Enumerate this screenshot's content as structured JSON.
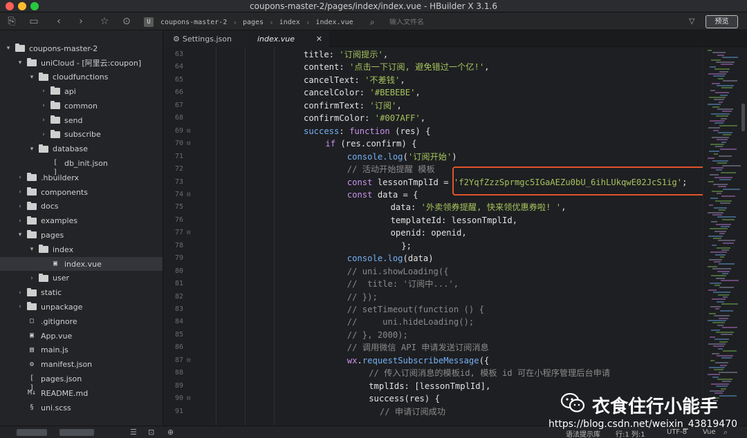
{
  "window": {
    "title": "coupons-master-2/pages/index/index.vue - HBuilder X 3.1.6"
  },
  "toolbar": {
    "breadcrumb": [
      "coupons-master-2",
      "pages",
      "index",
      "index.vue"
    ],
    "file_input_placeholder": "输入文件名",
    "preview_label": "预览"
  },
  "sidebar": {
    "items": [
      {
        "label": "coupons-master-2",
        "level": 0,
        "arrow": "▾",
        "icon": "folder-icon"
      },
      {
        "label": "uniCloud - [阿里云:coupon]",
        "level": 1,
        "arrow": "▾",
        "icon": "folder-icon"
      },
      {
        "label": "cloudfunctions",
        "level": 2,
        "arrow": "▾",
        "icon": "folder-icon"
      },
      {
        "label": "api",
        "level": 3,
        "arrow": "›",
        "icon": "folder-icon"
      },
      {
        "label": "common",
        "level": 3,
        "arrow": "›",
        "icon": "folder-icon"
      },
      {
        "label": "send",
        "level": 3,
        "arrow": "›",
        "icon": "folder-icon"
      },
      {
        "label": "subscribe",
        "level": 3,
        "arrow": "›",
        "icon": "folder-icon"
      },
      {
        "label": "database",
        "level": 2,
        "arrow": "▾",
        "icon": "folder-icon"
      },
      {
        "label": "db_init.json",
        "level": 3,
        "arrow": "",
        "icon": "json-file-icon"
      },
      {
        "label": ".hbuilderx",
        "level": 1,
        "arrow": "›",
        "icon": "folder-icon"
      },
      {
        "label": "components",
        "level": 1,
        "arrow": "›",
        "icon": "folder-icon"
      },
      {
        "label": "docs",
        "level": 1,
        "arrow": "›",
        "icon": "folder-icon"
      },
      {
        "label": "examples",
        "level": 1,
        "arrow": "›",
        "icon": "folder-icon"
      },
      {
        "label": "pages",
        "level": 1,
        "arrow": "▾",
        "icon": "folder-icon"
      },
      {
        "label": "index",
        "level": 2,
        "arrow": "▾",
        "icon": "folder-icon"
      },
      {
        "label": "index.vue",
        "level": 3,
        "arrow": "",
        "icon": "vue-file-icon",
        "selected": true
      },
      {
        "label": "user",
        "level": 2,
        "arrow": "›",
        "icon": "folder-icon"
      },
      {
        "label": "static",
        "level": 1,
        "arrow": "›",
        "icon": "folder-icon"
      },
      {
        "label": "unpackage",
        "level": 1,
        "arrow": "›",
        "icon": "folder-icon"
      },
      {
        "label": ".gitignore",
        "level": 1,
        "arrow": "",
        "icon": "file-icon"
      },
      {
        "label": "App.vue",
        "level": 1,
        "arrow": "",
        "icon": "vue-file-icon"
      },
      {
        "label": "main.js",
        "level": 1,
        "arrow": "",
        "icon": "js-file-icon"
      },
      {
        "label": "manifest.json",
        "level": 1,
        "arrow": "",
        "icon": "settings-file-icon"
      },
      {
        "label": "pages.json",
        "level": 1,
        "arrow": "",
        "icon": "json-file-icon"
      },
      {
        "label": "README.md",
        "level": 1,
        "arrow": "",
        "icon": "markdown-file-icon"
      },
      {
        "label": "uni.scss",
        "level": 1,
        "arrow": "",
        "icon": "scss-file-icon"
      }
    ]
  },
  "tabs": [
    {
      "label": "Settings.json",
      "active": false
    },
    {
      "label": "index.vue",
      "active": true
    }
  ],
  "editor": {
    "lines": [
      {
        "n": "63",
        "fold": "",
        "indent": 20,
        "tokens": [
          [
            "p",
            "title: "
          ],
          [
            "s",
            "'订阅提示'"
          ],
          [
            "p",
            ","
          ]
        ]
      },
      {
        "n": "64",
        "fold": "",
        "indent": 20,
        "tokens": [
          [
            "p",
            "content: "
          ],
          [
            "s",
            "'点击一下订阅, 避免错过一个亿!'"
          ],
          [
            "p",
            ","
          ]
        ]
      },
      {
        "n": "65",
        "fold": "",
        "indent": 20,
        "tokens": [
          [
            "p",
            "cancelText: "
          ],
          [
            "s",
            "'不差钱'"
          ],
          [
            "p",
            ","
          ]
        ]
      },
      {
        "n": "66",
        "fold": "",
        "indent": 20,
        "tokens": [
          [
            "p",
            "cancelColor: "
          ],
          [
            "s",
            "'#BEBEBE'"
          ],
          [
            "p",
            ","
          ]
        ]
      },
      {
        "n": "67",
        "fold": "",
        "indent": 20,
        "tokens": [
          [
            "p",
            "confirmText: "
          ],
          [
            "s",
            "'订阅'"
          ],
          [
            "p",
            ","
          ]
        ]
      },
      {
        "n": "68",
        "fold": "",
        "indent": 20,
        "tokens": [
          [
            "p",
            "confirmColor: "
          ],
          [
            "s",
            "'#007AFF'"
          ],
          [
            "p",
            ","
          ]
        ]
      },
      {
        "n": "69",
        "fold": "⊟",
        "indent": 20,
        "tokens": [
          [
            "b",
            "success"
          ],
          [
            "p",
            ": "
          ],
          [
            "k",
            "function"
          ],
          [
            "p",
            " (res) {"
          ]
        ]
      },
      {
        "n": "70",
        "fold": "⊟",
        "indent": 24,
        "tokens": [
          [
            "k",
            "if"
          ],
          [
            "p",
            " (res.confirm) {"
          ]
        ]
      },
      {
        "n": "71",
        "fold": "",
        "indent": 28,
        "tokens": [
          [
            "b",
            "console.log"
          ],
          [
            "p",
            "("
          ],
          [
            "s",
            "'订阅开始'"
          ],
          [
            "p",
            ")"
          ]
        ]
      },
      {
        "n": "72",
        "fold": "",
        "indent": 28,
        "tokens": [
          [
            "c",
            "// 活动开始提醒 模板"
          ]
        ]
      },
      {
        "n": "73",
        "fold": "",
        "indent": 28,
        "tokens": [
          [
            "k",
            "const"
          ],
          [
            "p",
            " lessonTmplId = "
          ],
          [
            "s",
            "'f2YqfZzzSprmgc5IGaAEZu0bU_6ihLUkqwE02JcS1ig'"
          ],
          [
            "p",
            ";"
          ]
        ]
      },
      {
        "n": "74",
        "fold": "⊟",
        "indent": 28,
        "tokens": [
          [
            "k",
            "const"
          ],
          [
            "p",
            " data = {"
          ]
        ]
      },
      {
        "n": "75",
        "fold": "",
        "indent": 36,
        "tokens": [
          [
            "p",
            "data: "
          ],
          [
            "s",
            "'外卖领券提醒, 快来领优惠券啦! '"
          ],
          [
            "p",
            ","
          ]
        ]
      },
      {
        "n": "76",
        "fold": "",
        "indent": 36,
        "tokens": [
          [
            "p",
            "templateId: lessonTmplId,"
          ]
        ]
      },
      {
        "n": "77",
        "fold": "⊟",
        "indent": 36,
        "tokens": [
          [
            "p",
            "openid: openid,"
          ]
        ]
      },
      {
        "n": "78",
        "fold": "",
        "indent": 38,
        "tokens": [
          [
            "p",
            "};"
          ]
        ]
      },
      {
        "n": "79",
        "fold": "",
        "indent": 28,
        "tokens": [
          [
            "b",
            "console.log"
          ],
          [
            "p",
            "(data)"
          ]
        ]
      },
      {
        "n": "80",
        "fold": "",
        "indent": 28,
        "tokens": [
          [
            "c",
            "// uni.showLoading({"
          ]
        ]
      },
      {
        "n": "81",
        "fold": "",
        "indent": 28,
        "tokens": [
          [
            "c",
            "//  title: '订阅中...',"
          ]
        ]
      },
      {
        "n": "82",
        "fold": "",
        "indent": 28,
        "tokens": [
          [
            "c",
            "// });"
          ]
        ]
      },
      {
        "n": "83",
        "fold": "",
        "indent": 28,
        "tokens": [
          [
            "c",
            "// setTimeout(function () {"
          ]
        ]
      },
      {
        "n": "84",
        "fold": "",
        "indent": 28,
        "tokens": [
          [
            "c",
            "//     uni.hideLoading();"
          ]
        ]
      },
      {
        "n": "85",
        "fold": "",
        "indent": 28,
        "tokens": [
          [
            "c",
            "// }, 2000);"
          ]
        ]
      },
      {
        "n": "86",
        "fold": "",
        "indent": 28,
        "tokens": [
          [
            "c",
            "// 调用微信 API 申请发送订阅消息"
          ]
        ]
      },
      {
        "n": "87",
        "fold": "⊟",
        "indent": 28,
        "tokens": [
          [
            "k",
            "wx"
          ],
          [
            "p",
            "."
          ],
          [
            "b",
            "requestSubscribeMessage"
          ],
          [
            "p",
            "({"
          ]
        ]
      },
      {
        "n": "88",
        "fold": "",
        "indent": 32,
        "tokens": [
          [
            "c",
            "// 传入订阅消息的模板id, 模板 id 可在小程序管理后台申请"
          ]
        ]
      },
      {
        "n": "89",
        "fold": "",
        "indent": 32,
        "tokens": [
          [
            "p",
            "tmplIds: [lessonTmplId],"
          ]
        ]
      },
      {
        "n": "90",
        "fold": "⊟",
        "indent": 32,
        "tokens": [
          [
            "p",
            "success(res) {"
          ]
        ]
      },
      {
        "n": "91",
        "fold": "",
        "indent": 34,
        "tokens": [
          [
            "c",
            "// 申请订阅成功"
          ]
        ]
      }
    ]
  },
  "statusbar": {
    "syntax_hint": "语法提示库",
    "position": "行:1  列:1",
    "encoding": "UTF-8",
    "language": "Vue"
  },
  "watermark": {
    "name": "衣食住行小能手",
    "url": "https://blog.csdn.net/weixin_43819470"
  },
  "colors": {
    "highlight_box": "#e2542a",
    "string": "#a5c25c",
    "keyword": "#c792ea",
    "function": "#74b0f4"
  }
}
